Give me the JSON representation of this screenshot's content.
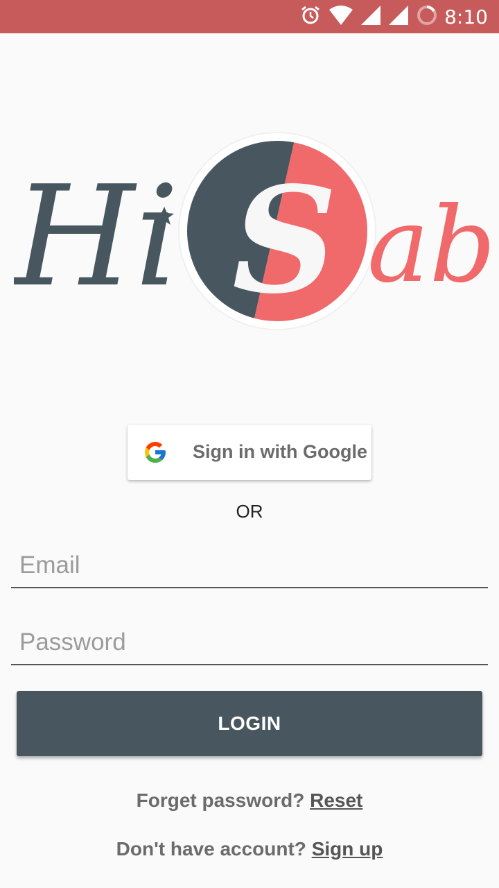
{
  "status_bar": {
    "time": "8:10",
    "icons": [
      "alarm-icon",
      "wifi-icon",
      "signal-icon",
      "signal-icon-2",
      "battery-charging-icon"
    ],
    "color": "#c75a5a"
  },
  "logo": {
    "text_left": "Hi",
    "letter_middle": "S",
    "text_right": "ab",
    "colors": {
      "dark": "#48575f",
      "accent": "#f06a6b"
    }
  },
  "google_button": {
    "label": "Sign in with Google"
  },
  "separator": {
    "text": "OR"
  },
  "form": {
    "email_placeholder": "Email",
    "password_placeholder": "Password",
    "login_label": "LOGIN"
  },
  "links": {
    "forgot_text": "Forget password?",
    "reset_label": "Reset",
    "signup_text": "Don't have account?",
    "signup_label": "Sign up"
  }
}
